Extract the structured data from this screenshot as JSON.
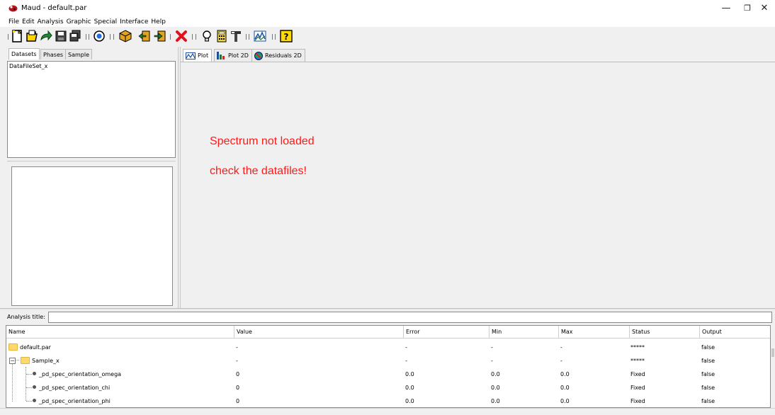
{
  "window": {
    "title": "Maud - default.par",
    "minimize_glyph": "—",
    "restore_glyph": "❐",
    "close_glyph": "✕"
  },
  "menu": [
    "File",
    "Edit",
    "Analysis",
    "Graphic",
    "Special",
    "Interface",
    "Help"
  ],
  "toolbar_icons": [
    "new-file-icon",
    "open-folder-icon",
    "refresh-arrow-icon",
    "save-icon",
    "save-all-icon",
    "radio-target-icon",
    "box-icon",
    "import-icon",
    "export-icon",
    "delete-x-icon",
    "lightbulb-icon",
    "calculator-icon",
    "hammer-icon",
    "plot-icon",
    "help-icon"
  ],
  "left_tabs": [
    "Datasets",
    "Phases",
    "Sample"
  ],
  "datasets": [
    "DataFileSet_x"
  ],
  "right_tabs": [
    "Plot",
    "Plot 2D",
    "Residuals 2D"
  ],
  "plot_messages": [
    "Spectrum not loaded",
    "check the datafiles!"
  ],
  "analysis_title_label": "Analysis title:",
  "table": {
    "columns": [
      "Name",
      "Value",
      "Error",
      "Min",
      "Max",
      "Status",
      "Output"
    ],
    "rows": [
      {
        "name": "default.par",
        "value": "-",
        "error": "-",
        "min": "-",
        "max": "-",
        "status": "*****",
        "output": "false"
      },
      {
        "name": "Sample_x",
        "value": "-",
        "error": "-",
        "min": "-",
        "max": "-",
        "status": "*****",
        "output": "false"
      },
      {
        "name": "_pd_spec_orientation_omega",
        "value": "0",
        "error": "0.0",
        "min": "0.0",
        "max": "0.0",
        "status": "Fixed",
        "output": "false"
      },
      {
        "name": "_pd_spec_orientation_chi",
        "value": "0",
        "error": "0.0",
        "min": "0.0",
        "max": "0.0",
        "status": "Fixed",
        "output": "false"
      },
      {
        "name": "_pd_spec_orientation_phi",
        "value": "0",
        "error": "0.0",
        "min": "0.0",
        "max": "0.0",
        "status": "Fixed",
        "output": "false"
      }
    ]
  },
  "colors": {
    "message": "#ff1a1a",
    "background": "#f0f0f0",
    "folder": "#ffd86b"
  }
}
